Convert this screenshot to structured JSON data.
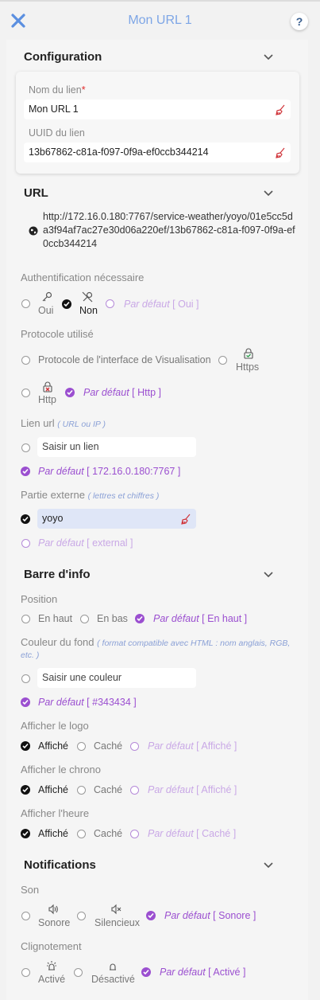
{
  "header": {
    "title": "Mon URL 1",
    "help": "?"
  },
  "configuration": {
    "title": "Configuration",
    "name_label": "Nom du lien",
    "required_mark": "*",
    "name_value": "Mon URL 1",
    "uuid_label": "UUID du lien",
    "uuid_value": "13b67862-c81a-f097-0f9a-ef0ccb344214"
  },
  "url": {
    "title": "URL",
    "full": "http://172.16.0.180:7767/service-weather/yoyo/01e5cc5da3f94af7ac27e30d06a220ef/13b67862-c81a-f097-0f9a-ef0ccb344214",
    "auth": {
      "label": "Authentification nécessaire",
      "opt_yes": "Oui",
      "opt_no": "Non",
      "default_prefix": "Par défaut",
      "default_value": "[ Oui ]"
    },
    "protocol": {
      "label": "Protocole utilisé",
      "opt_interface": "Protocole de l'interface de Visualisation",
      "opt_https": "Https",
      "opt_http": "Http",
      "default_prefix": "Par défaut",
      "default_value": "[ Http ]"
    },
    "link": {
      "label": "Lien url",
      "hint": "( URL ou IP )",
      "placeholder": "Saisir un lien",
      "default_prefix": "Par défaut",
      "default_value": "[ 172.16.0.180:7767 ]"
    },
    "external": {
      "label": "Partie externe",
      "hint": "( lettres et chiffres )",
      "value": "yoyo",
      "default_prefix": "Par défaut",
      "default_value": "[ external ]"
    }
  },
  "infobar": {
    "title": "Barre d'info",
    "position": {
      "label": "Position",
      "opt_top": "En haut",
      "opt_bottom": "En bas",
      "default_prefix": "Par défaut",
      "default_value": "[ En haut ]"
    },
    "bg": {
      "label": "Couleur du fond",
      "hint": "( format compatible avec HTML : nom anglais, RGB, etc. )",
      "placeholder": "Saisir une couleur",
      "default_prefix": "Par défaut",
      "default_value": "[ #343434 ]"
    },
    "logo": {
      "label": "Afficher le logo",
      "opt_shown": "Affiché",
      "opt_hidden": "Caché",
      "default_prefix": "Par défaut",
      "default_value": "[ Affiché ]"
    },
    "chrono": {
      "label": "Afficher le chrono",
      "opt_shown": "Affiché",
      "opt_hidden": "Caché",
      "default_prefix": "Par défaut",
      "default_value": "[ Affiché ]"
    },
    "time": {
      "label": "Afficher l'heure",
      "opt_shown": "Affiché",
      "opt_hidden": "Caché",
      "default_prefix": "Par défaut",
      "default_value": "[ Caché ]"
    }
  },
  "notifications": {
    "title": "Notifications",
    "sound": {
      "label": "Son",
      "opt_on": "Sonore",
      "opt_off": "Silencieux",
      "default_prefix": "Par défaut",
      "default_value": "[ Sonore ]"
    },
    "blink": {
      "label": "Clignotement",
      "opt_on": "Activé",
      "opt_off": "Désactivé",
      "default_prefix": "Par défaut",
      "default_value": "[ Activé ]"
    }
  },
  "colors": {
    "accent": "#9b4fd0",
    "header_title": "#7ea6e6",
    "close": "#5b8fe0",
    "broom": "#d0343a",
    "hint": "#8aa0d6"
  },
  "icons": [
    "close-icon",
    "help-icon",
    "chevron-down-icon",
    "broom-icon",
    "globe-icon",
    "key-icon",
    "key-off-icon",
    "lock-check-icon",
    "lock-x-icon",
    "sound-on-icon",
    "sound-off-icon",
    "blink-on-icon",
    "blink-off-icon",
    "check-icon"
  ]
}
